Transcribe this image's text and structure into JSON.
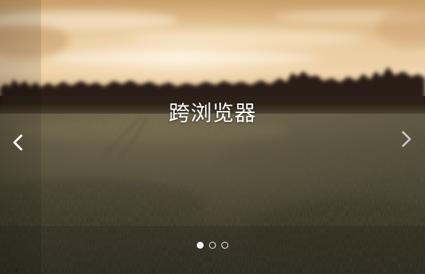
{
  "slide": {
    "caption": "跨浏览器",
    "image": "sunset-field-landscape"
  },
  "navigation": {
    "prev_icon": "chevron-left-icon",
    "next_icon": "chevron-right-icon",
    "prev_color": "#ffffff",
    "next_color": "#c9c9c9"
  },
  "indicators": {
    "count": 3,
    "active_index": 0
  },
  "colors": {
    "sky_top": "#c9a06a",
    "sky_glow": "#f3dcb6",
    "treeline": "#241a12",
    "field": "#474230"
  }
}
